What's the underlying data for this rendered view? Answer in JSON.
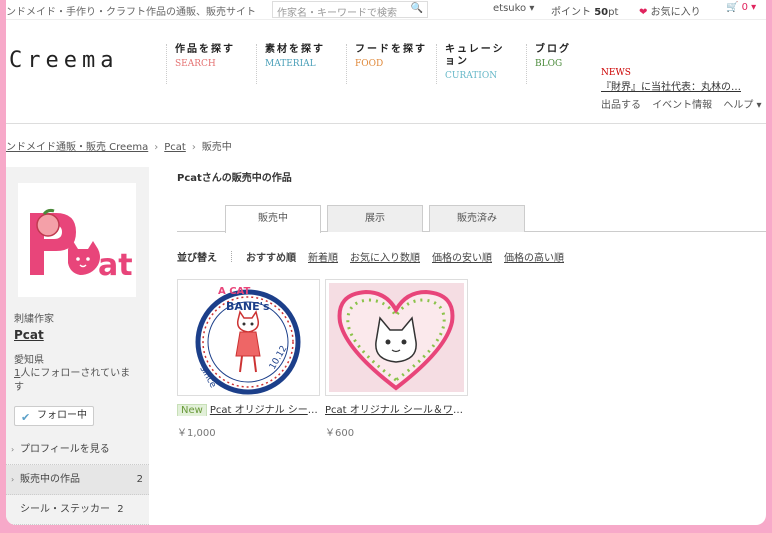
{
  "topbar": {
    "tagline": "ンドメイド・手作り・クラフト作品の通販、販売サイト",
    "search_placeholder": "作家名・キーワードで検索",
    "username": "etsuko ▾",
    "points_label": "ポイント",
    "points_value": "50",
    "points_unit": "pt",
    "favorites": "お気に入り",
    "cart_count": "0 ▾"
  },
  "header": {
    "logo": "Creema",
    "nav": [
      {
        "jp": "作品を探す",
        "en": "SEARCH",
        "color": "#e57373"
      },
      {
        "jp": "素材を探す",
        "en": "MATERIAL",
        "color": "#4a9fb8"
      },
      {
        "jp": "フードを探す",
        "en": "FOOD",
        "color": "#e08a3c"
      },
      {
        "jp": "キュレーション",
        "en": "CURATION",
        "color": "#66b8c8"
      },
      {
        "jp": "ブログ",
        "en": "BLOG",
        "color": "#4a8a3a"
      }
    ],
    "news_label": "NEWS",
    "news_text": "『財界』に当社代表：丸林の…",
    "sublinks": [
      "出品する",
      "イベント情報",
      "ヘルプ ▾"
    ]
  },
  "breadcrumb": [
    "ンドメイド通販・販売 Creema",
    "Pcat",
    "販売中"
  ],
  "sidebar": {
    "role": "刺繍作家",
    "name": "Pcat",
    "prefecture": "愛知県",
    "follower_count": "1",
    "followers_text": "人にフォローされています",
    "follow_button": "フォロー中",
    "links": [
      {
        "label": "プロフィールを見る",
        "count": ""
      },
      {
        "label": "販売中の作品",
        "count": "2"
      },
      {
        "label": "シール・ステッカー",
        "count": "2"
      }
    ]
  },
  "main": {
    "title": "Pcatさんの販売中の作品",
    "tabs": [
      "販売中",
      "展示",
      "販売済み"
    ],
    "sort_label": "並び替え",
    "sort_options": [
      "おすすめ順",
      "新着順",
      "お気に入り数順",
      "価格の安い順",
      "価格の高い順"
    ],
    "items": [
      {
        "new": "New",
        "title": "Pcat オリジナル シール…",
        "price": "￥1,000"
      },
      {
        "new": "",
        "title": "Pcat オリジナル シール＆ワッ…",
        "price": "￥600"
      }
    ]
  }
}
